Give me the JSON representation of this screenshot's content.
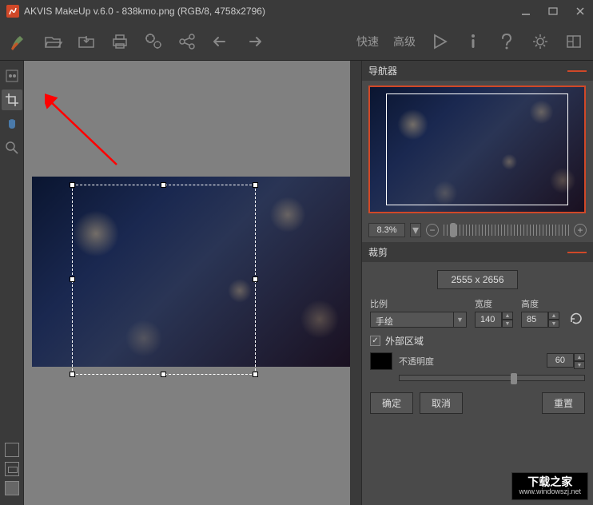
{
  "titlebar": {
    "title": "AKVIS MakeUp v.6.0 - 838kmo.png (RGB/8, 4758x2796)"
  },
  "toolbar": {
    "mode_fast": "快速",
    "mode_advanced": "高级"
  },
  "navigator": {
    "heading": "导航器",
    "zoom_value": "8.3%"
  },
  "crop": {
    "heading": "裁剪",
    "dimensions": "2555 x 2656",
    "ratio_label": "比例",
    "ratio_value": "手绘",
    "width_label": "宽度",
    "width_value": "140",
    "height_label": "高度",
    "height_value": "85",
    "external_area_label": "外部区域",
    "external_area_checked": "✓",
    "opacity_label": "不透明度",
    "opacity_value": "60",
    "btn_ok": "确定",
    "btn_cancel": "取消",
    "btn_reset": "重置"
  },
  "watermark": {
    "line1": "下载之家",
    "line2": "www.windowszj.net"
  }
}
